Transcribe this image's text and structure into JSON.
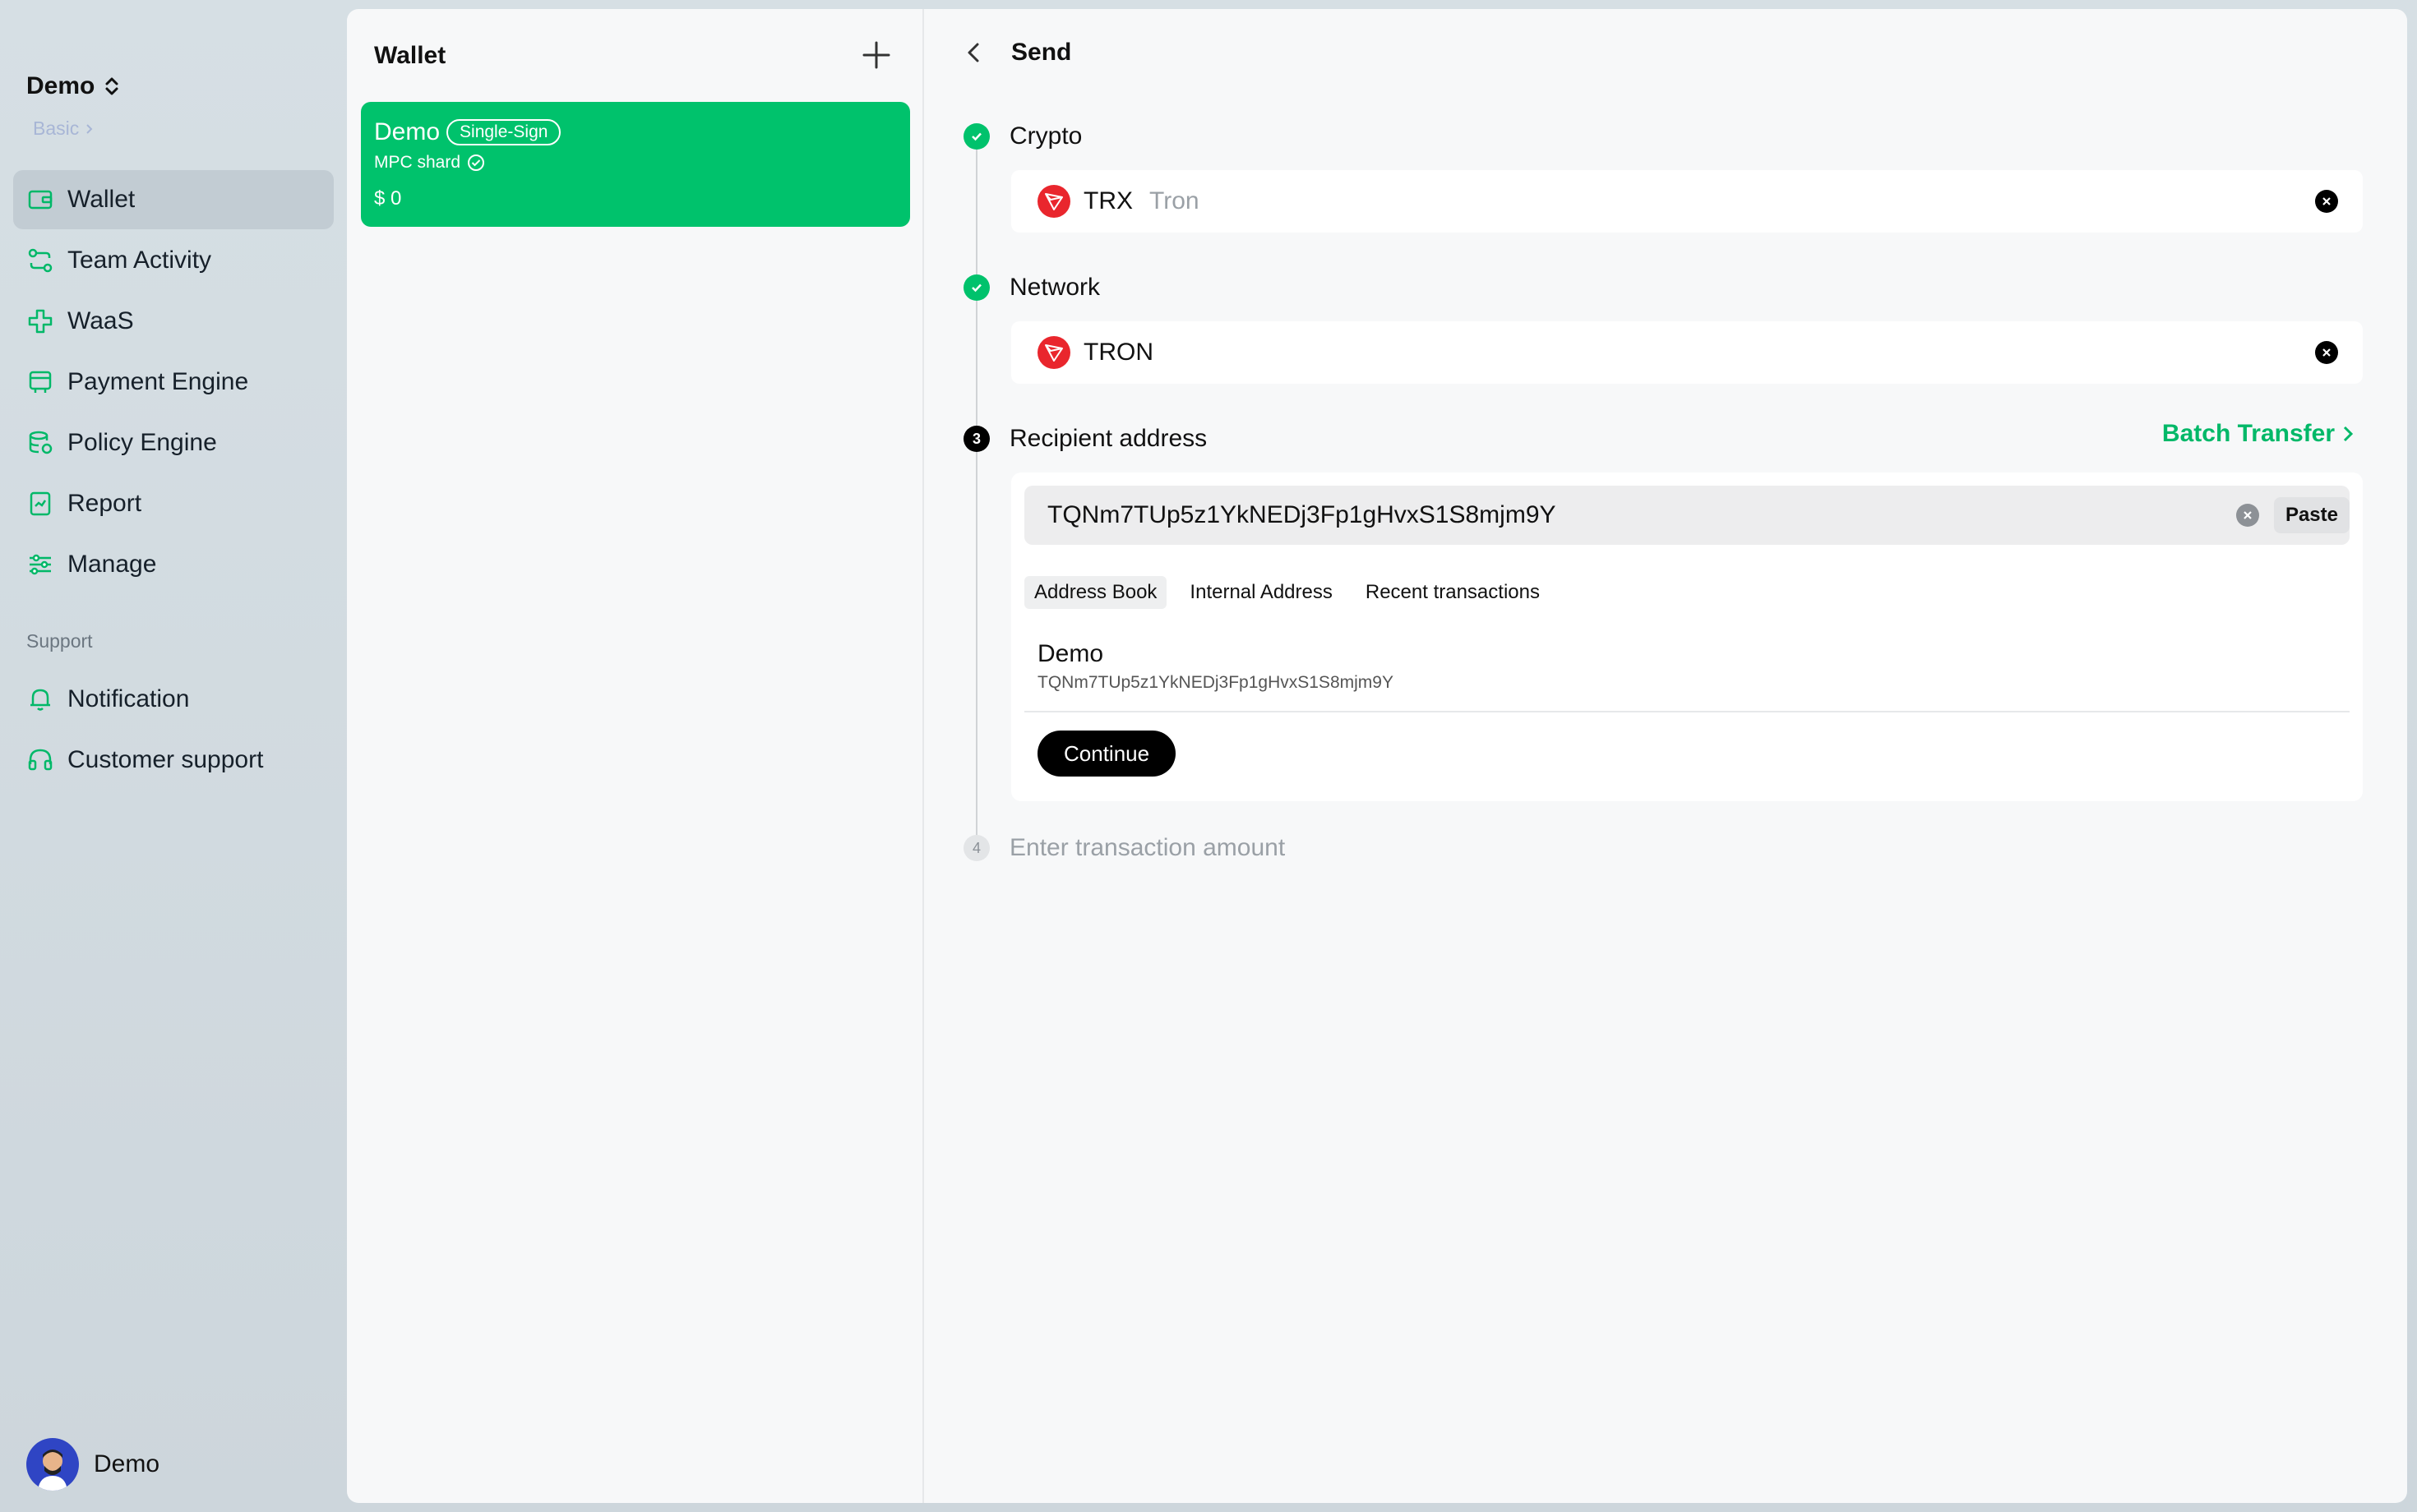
{
  "org": {
    "name": "Demo",
    "plan": "Basic"
  },
  "nav": {
    "items": [
      {
        "label": "Wallet",
        "icon": "wallet-icon"
      },
      {
        "label": "Team Activity",
        "icon": "team-activity-icon"
      },
      {
        "label": "WaaS",
        "icon": "waas-icon"
      },
      {
        "label": "Payment Engine",
        "icon": "payment-engine-icon"
      },
      {
        "label": "Policy Engine",
        "icon": "policy-engine-icon"
      },
      {
        "label": "Report",
        "icon": "report-icon"
      },
      {
        "label": "Manage",
        "icon": "manage-icon"
      }
    ],
    "support_heading": "Support",
    "support_items": [
      {
        "label": "Notification",
        "icon": "bell-icon"
      },
      {
        "label": "Customer support",
        "icon": "headset-icon"
      }
    ]
  },
  "user": {
    "name": "Demo"
  },
  "wallet_panel": {
    "title": "Wallet",
    "card": {
      "name": "Demo",
      "badge": "Single-Sign",
      "type": "MPC shard",
      "balance": "$ 0"
    }
  },
  "send": {
    "title": "Send",
    "steps": {
      "crypto": {
        "label": "Crypto",
        "symbol": "TRX",
        "name": "Tron"
      },
      "network": {
        "label": "Network",
        "value": "TRON"
      },
      "recipient": {
        "number": "3",
        "label": "Recipient address",
        "batch_label": "Batch Transfer",
        "address_value": "TQNm7TUp5z1YkNEDj3Fp1gHvxS1S8mjm9Y",
        "paste_label": "Paste",
        "tabs": [
          "Address Book",
          "Internal Address",
          "Recent transactions"
        ],
        "book_entry": {
          "name": "Demo",
          "address": "TQNm7TUp5z1YkNEDj3Fp1gHvxS1S8mjm9Y"
        },
        "continue_label": "Continue"
      },
      "amount": {
        "number": "4",
        "label": "Enter transaction amount"
      }
    }
  },
  "colors": {
    "accent": "#00c26c",
    "tron": "#e9262d",
    "accent_text": "#00b868"
  }
}
